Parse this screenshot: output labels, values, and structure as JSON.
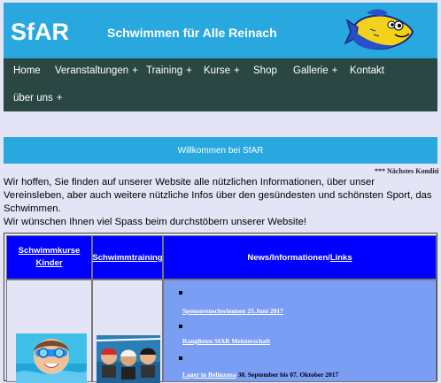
{
  "header": {
    "logo": "SfAR",
    "title": "Schwimmen für Alle Reinach"
  },
  "nav": {
    "items": [
      {
        "label": "Home",
        "has_sub": false
      },
      {
        "label": "Veranstaltungen",
        "has_sub": true
      },
      {
        "label": "Training",
        "has_sub": true
      },
      {
        "label": "Kurse",
        "has_sub": true
      },
      {
        "label": "Shop",
        "has_sub": false
      },
      {
        "label": "Gallerie",
        "has_sub": true
      },
      {
        "label": "Kontakt",
        "has_sub": false
      },
      {
        "label": "über uns",
        "has_sub": true
      }
    ],
    "sub_marker": "+"
  },
  "banner": {
    "text": "Willkommen bei SfAR"
  },
  "ticker": {
    "text": "*** Nächstes Konditi"
  },
  "intro": {
    "paragraph1": "Wir hoffen, Sie finden auf unserer Website alle nützlichen Informationen, über unser Vereinsleben, aber auch weitere nützliche Infos über den gesündesten und schönsten Sport, das Schwimmen.",
    "paragraph2": "Wir wünschen Ihnen viel Spass beim durchstöbern unserer Website!"
  },
  "table": {
    "col1_header": "Schwimmkurse Kinder",
    "col2_header": "Schwimmtraining",
    "col3_header_prefix": "News/Informationen/",
    "col3_header_link": "Links",
    "news": [
      {
        "link": "Sponsorenschwimmen 25.Juni 2017",
        "extra": ""
      },
      {
        "link": "Ranglisten SfAR Meisterschaft",
        "extra": ""
      },
      {
        "link": "Lager in Belinzona",
        "extra": " 30. September bis 07. Oktober 2017"
      }
    ]
  },
  "colors": {
    "header_bg": "#29a8e0",
    "nav_bg": "#2a4744",
    "page_bg": "#e4e4f7",
    "table_header_bg": "#0000ff",
    "news_bg": "#7b9ef5"
  }
}
